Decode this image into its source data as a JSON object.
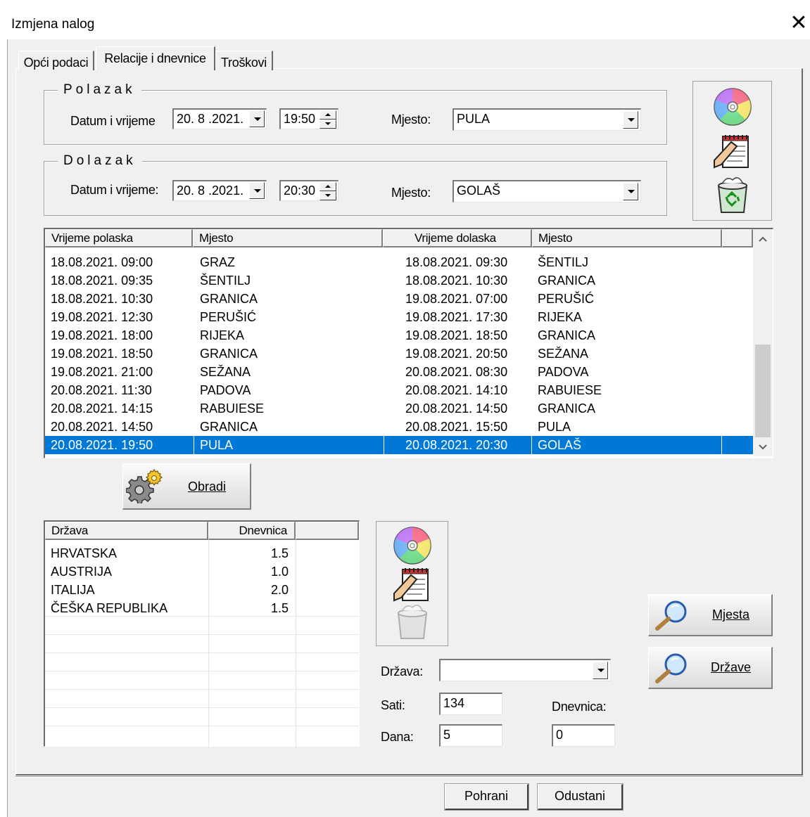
{
  "window": {
    "title": "Izmjena nalog",
    "close_glyph": "✕"
  },
  "tabs": [
    {
      "label": "Opći podaci",
      "active": false
    },
    {
      "label": "Relacije i dnevnice",
      "active": true
    },
    {
      "label": "Troškovi",
      "active": false
    }
  ],
  "polazak": {
    "legend": "Polazak",
    "datetime_label": "Datum i vrijeme",
    "date": "20. 8 .2021.",
    "time": "19:50",
    "place_label": "Mjesto:",
    "place": "PULA"
  },
  "dolazak": {
    "legend": "Dolazak",
    "datetime_label": "Datum i vrijeme:",
    "date": "20. 8 .2021.",
    "time": "20:30",
    "place_label": "Mjesto:",
    "place": "GOLAŠ"
  },
  "relations_table": {
    "headers": [
      "Vrijeme polaska",
      "Mjesto",
      "Vrijeme dolaska",
      "Mjesto"
    ],
    "rows": [
      {
        "dep_time": "18.08.2021.  09:00",
        "dep_place": "GRAZ",
        "arr_time": "18.08.2021.  09:30",
        "arr_place": "ŠENTILJ"
      },
      {
        "dep_time": "18.08.2021.  09:35",
        "dep_place": "ŠENTILJ",
        "arr_time": "18.08.2021.  10:30",
        "arr_place": "GRANICA"
      },
      {
        "dep_time": "18.08.2021.  10:30",
        "dep_place": "GRANICA",
        "arr_time": "19.08.2021.  07:00",
        "arr_place": "PERUŠIĆ"
      },
      {
        "dep_time": "19.08.2021.  12:30",
        "dep_place": "PERUŠIĆ",
        "arr_time": "19.08.2021.  17:30",
        "arr_place": "RIJEKA"
      },
      {
        "dep_time": "19.08.2021.  18:00",
        "dep_place": "RIJEKA",
        "arr_time": "19.08.2021.  18:50",
        "arr_place": "GRANICA"
      },
      {
        "dep_time": "19.08.2021.  18:50",
        "dep_place": "GRANICA",
        "arr_time": "19.08.2021.  20:50",
        "arr_place": "SEŽANA"
      },
      {
        "dep_time": "19.08.2021.  21:00",
        "dep_place": "SEŽANA",
        "arr_time": "20.08.2021.  08:30",
        "arr_place": "PADOVA"
      },
      {
        "dep_time": "20.08.2021.  11:30",
        "dep_place": "PADOVA",
        "arr_time": "20.08.2021.  14:10",
        "arr_place": "RABUIESE"
      },
      {
        "dep_time": "20.08.2021.  14:15",
        "dep_place": "RABUIESE",
        "arr_time": "20.08.2021.  14:50",
        "arr_place": "GRANICA"
      },
      {
        "dep_time": "20.08.2021.  14:50",
        "dep_place": "GRANICA",
        "arr_time": "20.08.2021.  15:50",
        "arr_place": "PULA"
      },
      {
        "dep_time": "20.08.2021.  19:50",
        "dep_place": "PULA",
        "arr_time": "20.08.2021.  20:30",
        "arr_place": "GOLAŠ",
        "selected": true
      }
    ]
  },
  "obradi_button": {
    "label": "Obradi"
  },
  "countries_table": {
    "headers": [
      "Država",
      "Dnevnica"
    ],
    "rows": [
      {
        "country": "HRVATSKA",
        "allowance": "1.5"
      },
      {
        "country": "AUSTRIJA",
        "allowance": "1.0"
      },
      {
        "country": "ITALIJA",
        "allowance": "2.0"
      },
      {
        "country": "ČEŠKA REPUBLIKA",
        "allowance": "1.5"
      }
    ]
  },
  "detail_form": {
    "country_label": "Država:",
    "country_value": "",
    "hours_label": "Sati:",
    "hours_value": "134",
    "days_label": "Dana:",
    "days_value": "5",
    "allowance_label": "Dnevnica:",
    "allowance_value": "0"
  },
  "side_buttons": {
    "places": "Mjesta",
    "countries": "Države"
  },
  "footer": {
    "save": "Pohrani",
    "cancel": "Odustani"
  },
  "icons": {
    "save": "cd-disk-icon",
    "edit": "notepad-edit-icon",
    "delete": "recycle-bin-icon",
    "process": "gears-icon",
    "search": "magnifier-icon"
  }
}
